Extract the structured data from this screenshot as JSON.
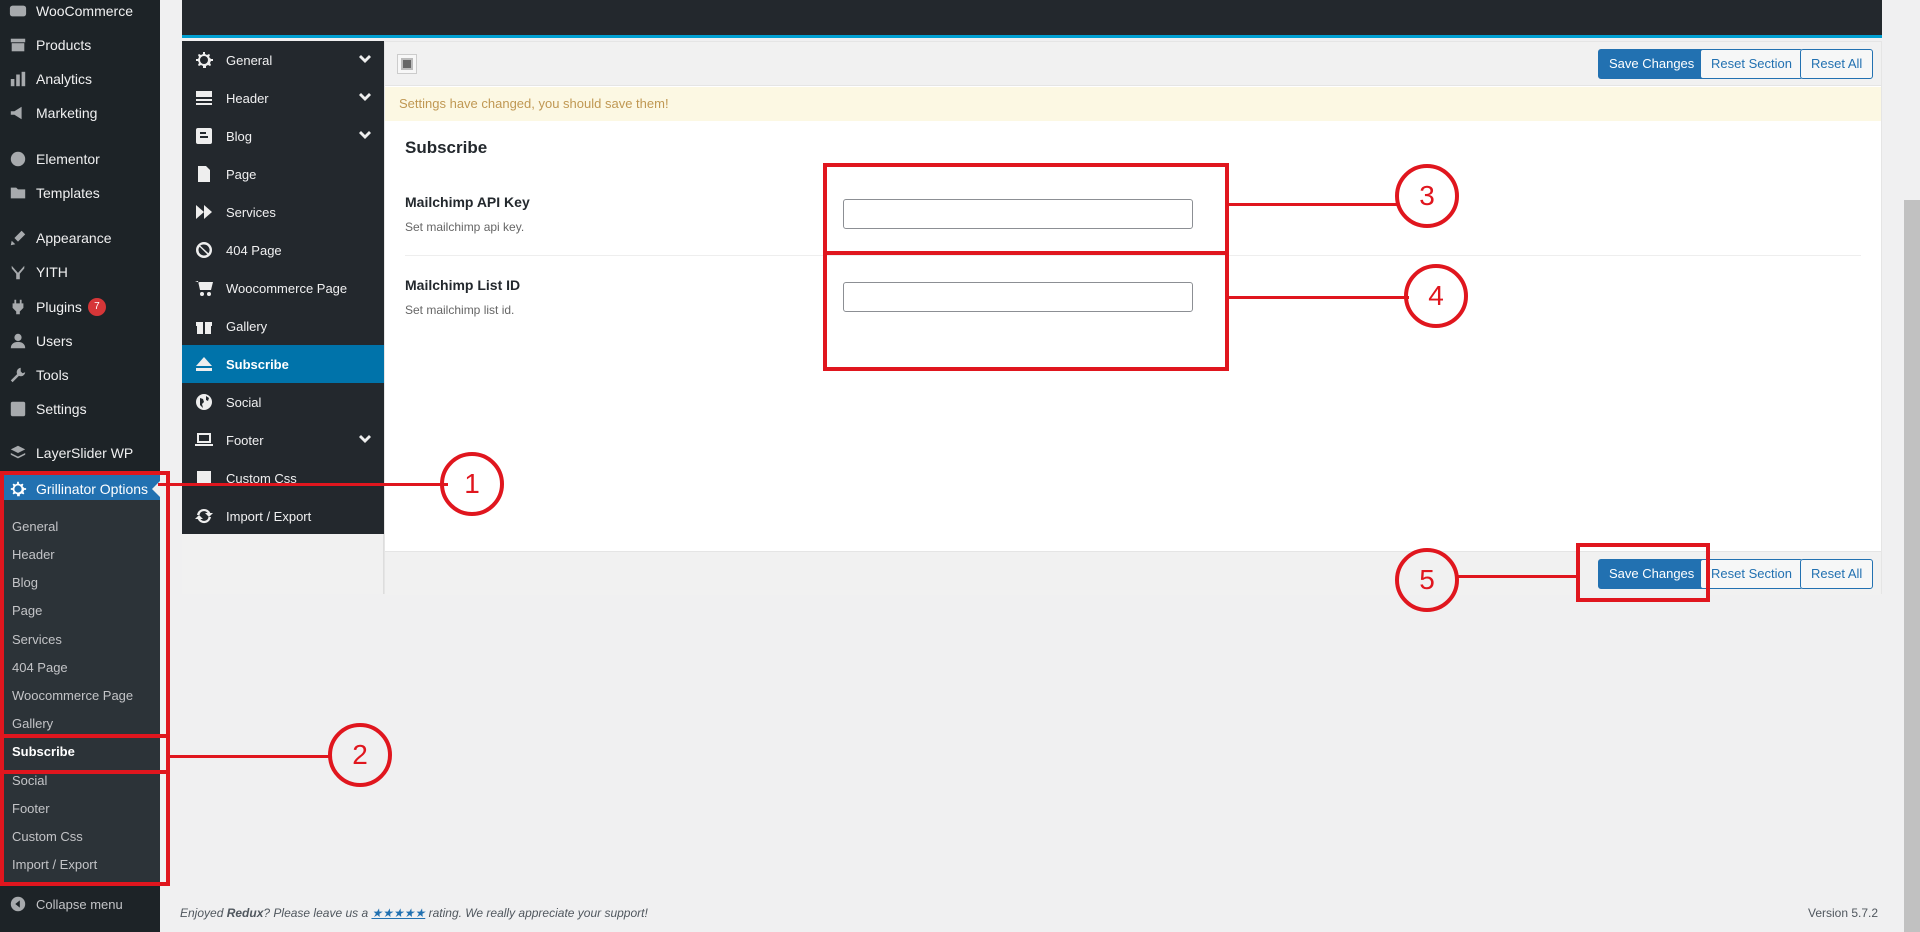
{
  "wp_menu": {
    "items": [
      {
        "label": "WooCommerce",
        "icon": "woo-icon"
      },
      {
        "label": "Products",
        "icon": "archive-icon"
      },
      {
        "label": "Analytics",
        "icon": "chart-bar-icon"
      },
      {
        "label": "Marketing",
        "icon": "megaphone-icon"
      },
      {
        "label": "Elementor",
        "icon": "elementor-icon"
      },
      {
        "label": "Templates",
        "icon": "folder-icon"
      },
      {
        "label": "Appearance",
        "icon": "paintbrush-icon"
      },
      {
        "label": "YITH",
        "icon": "yith-icon"
      },
      {
        "label": "Plugins",
        "icon": "plugin-icon",
        "badge": "7"
      },
      {
        "label": "Users",
        "icon": "user-icon"
      },
      {
        "label": "Tools",
        "icon": "wrench-icon"
      },
      {
        "label": "Settings",
        "icon": "settings-icon"
      },
      {
        "label": "LayerSlider WP",
        "icon": "layers-icon"
      },
      {
        "label": "Grillinator Options",
        "icon": "gear-icon"
      }
    ],
    "submenu": [
      "General",
      "Header",
      "Blog",
      "Page",
      "Services",
      "404 Page",
      "Woocommerce Page",
      "Gallery",
      "Subscribe",
      "Social",
      "Footer",
      "Custom Css",
      "Import / Export"
    ],
    "collapse_label": "Collapse menu"
  },
  "redux_nav": {
    "items": [
      "General",
      "Header",
      "Blog",
      "Page",
      "Services",
      "404 Page",
      "Woocommerce Page",
      "Gallery",
      "Subscribe",
      "Social",
      "Footer",
      "Custom Css",
      "Import / Export"
    ]
  },
  "toolbar": {
    "save_label": "Save Changes",
    "reset_section_label": "Reset Section",
    "reset_all_label": "Reset All"
  },
  "notice": "Settings have changed, you should save them!",
  "section": {
    "title": "Subscribe",
    "fields": [
      {
        "label": "Mailchimp API Key",
        "desc": "Set mailchimp api key.",
        "value": ""
      },
      {
        "label": "Mailchimp List ID",
        "desc": "Set mailchimp list id.",
        "value": ""
      }
    ]
  },
  "annotations": [
    "1",
    "2",
    "3",
    "4",
    "5"
  ],
  "footer": {
    "prefix": "Enjoyed ",
    "brand": "Redux",
    "mid": "? Please leave us a ",
    "stars": "★★★★★",
    "suffix": " rating. We really appreciate your support!",
    "version": "Version 5.7.2"
  },
  "colors": {
    "annotation": "#e0161e",
    "accent": "#2271b1",
    "redux_active": "#0073aa",
    "sidebar_bg": "#1d2327"
  }
}
